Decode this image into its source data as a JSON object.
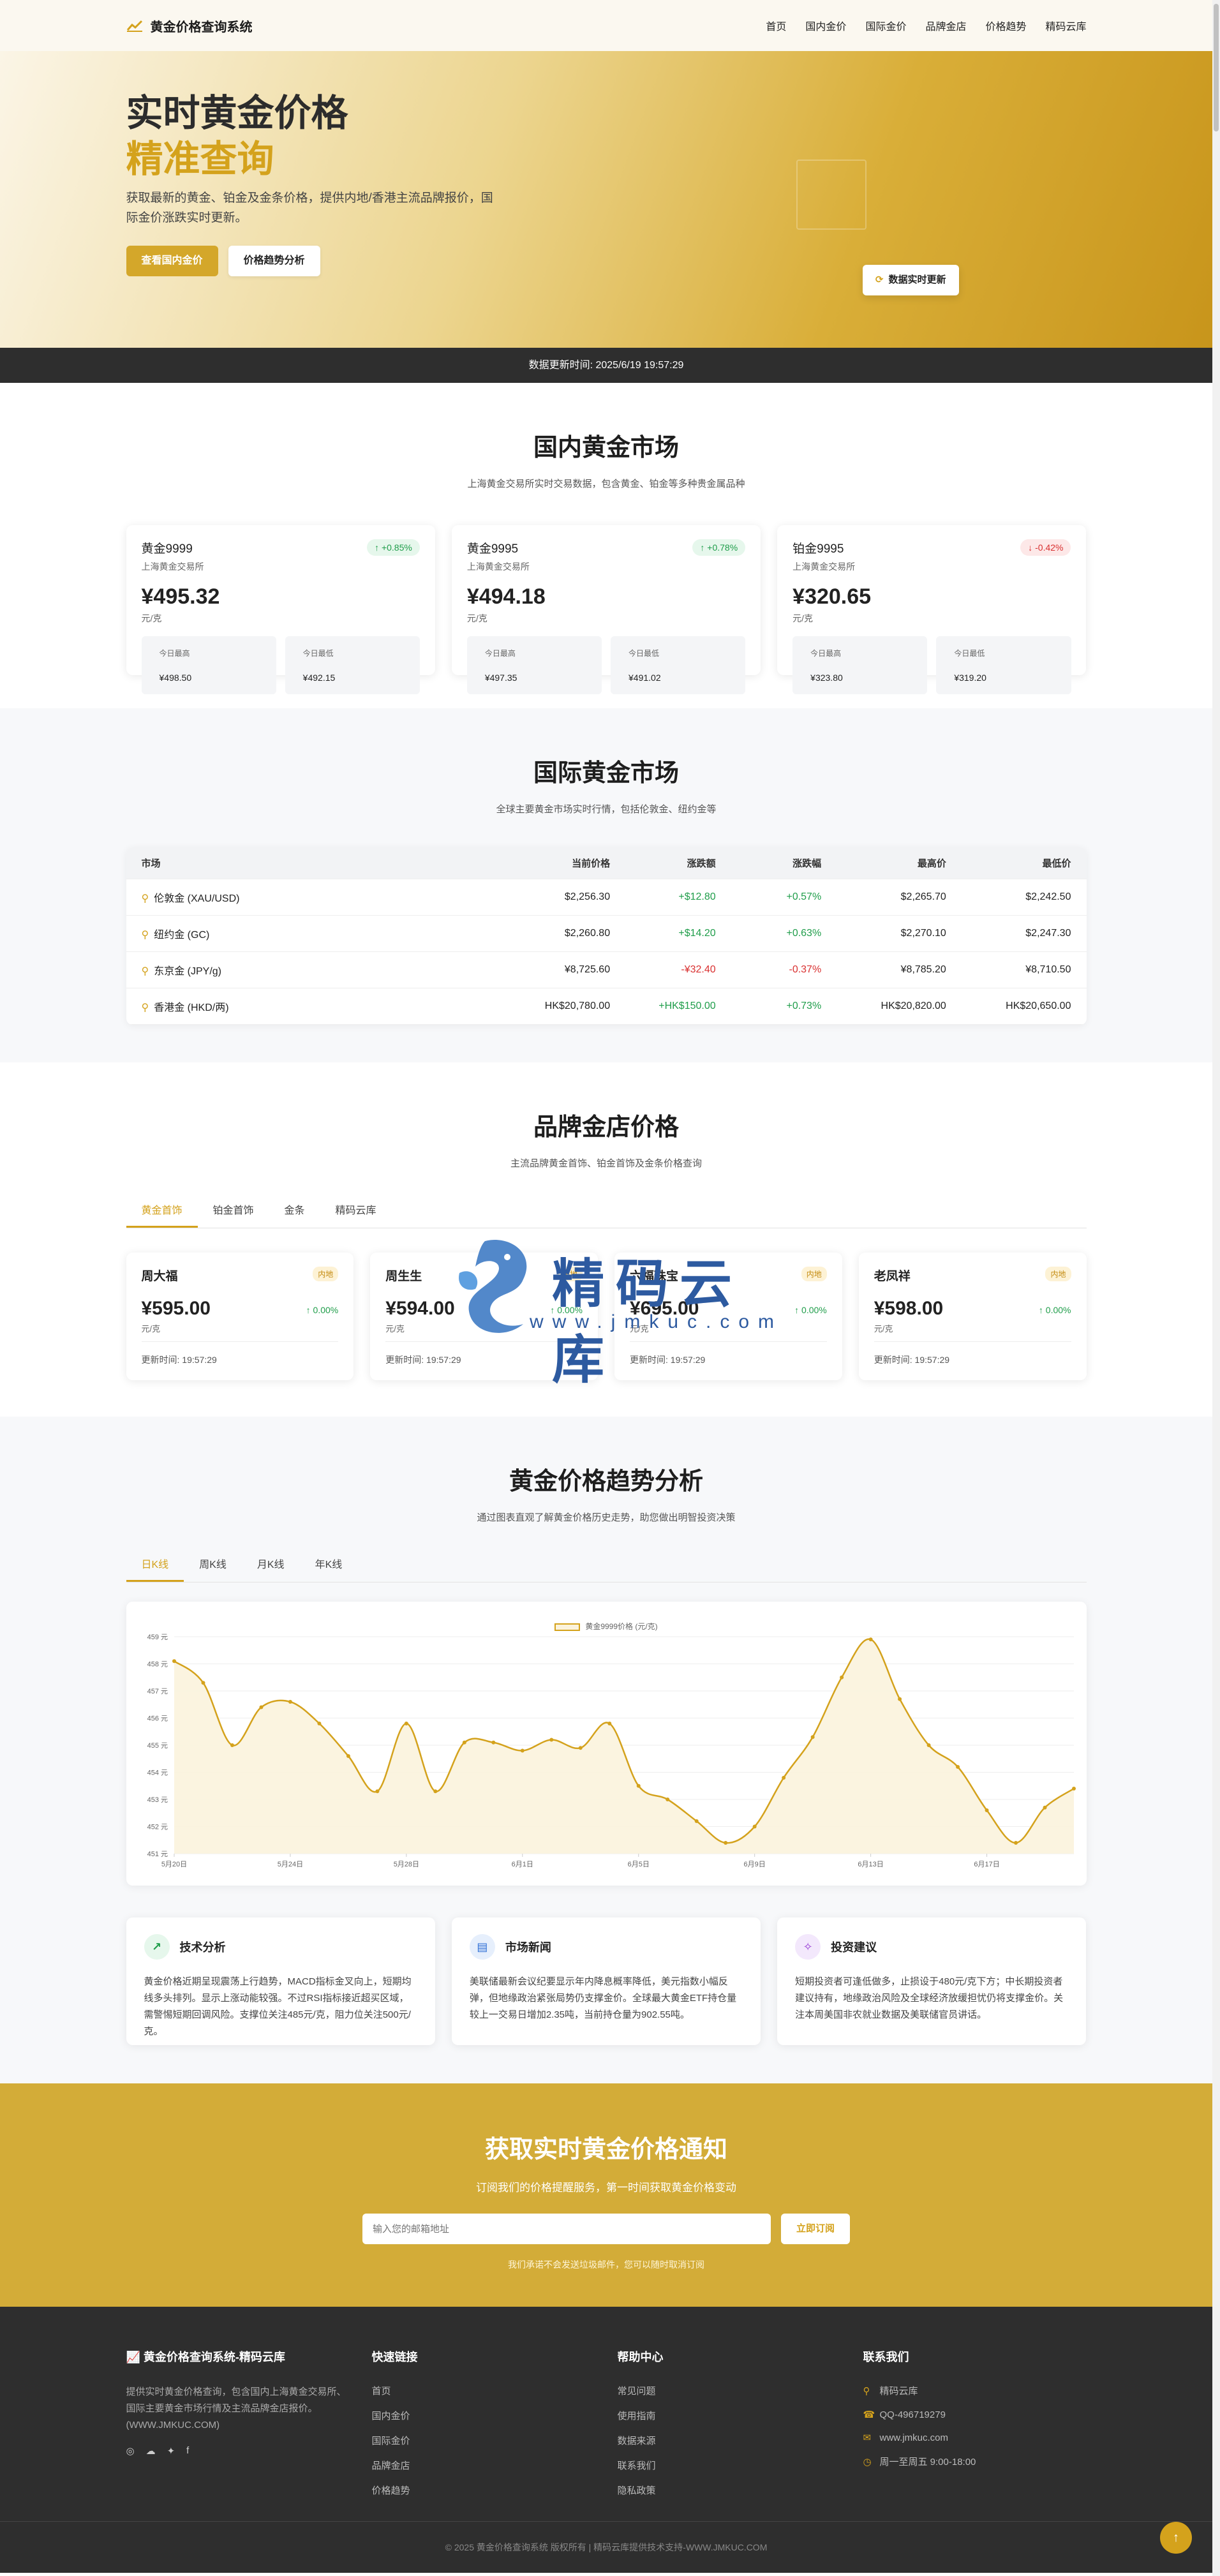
{
  "nav": {
    "brand": "黄金价格查询系统",
    "links": [
      "首页",
      "国内金价",
      "国际金价",
      "品牌金店",
      "价格趋势",
      "精码云库"
    ]
  },
  "hero": {
    "title_line1": "实时黄金价格",
    "title_line2": "精准查询",
    "desc": "获取最新的黄金、铂金及金条价格，提供内地/香港主流品牌报价，国际金价涨跌实时更新。",
    "btn_primary": "查看国内金价",
    "btn_secondary": "价格趋势分析",
    "live_label": "数据实时更新"
  },
  "update_bar": "数据更新时间: 2025/6/19 19:57:29",
  "domestic": {
    "title": "国内黄金市场",
    "subtitle": "上海黄金交易所实时交易数据，包含黄金、铂金等多种贵金属品种",
    "cards": [
      {
        "name": "黄金9999",
        "exchange": "上海黄金交易所",
        "change": "+0.85%",
        "dir": "up",
        "price": "¥495.32",
        "unit": "元/克",
        "high_label": "今日最高",
        "high": "¥498.50",
        "low_label": "今日最低",
        "low": "¥492.15"
      },
      {
        "name": "黄金9995",
        "exchange": "上海黄金交易所",
        "change": "+0.78%",
        "dir": "up",
        "price": "¥494.18",
        "unit": "元/克",
        "high_label": "今日最高",
        "high": "¥497.35",
        "low_label": "今日最低",
        "low": "¥491.02"
      },
      {
        "name": "铂金9995",
        "exchange": "上海黄金交易所",
        "change": "-0.42%",
        "dir": "down",
        "price": "¥320.65",
        "unit": "元/克",
        "high_label": "今日最高",
        "high": "¥323.80",
        "low_label": "今日最低",
        "low": "¥319.20"
      }
    ]
  },
  "intl": {
    "title": "国际黄金市场",
    "subtitle": "全球主要黄金市场实时行情，包括伦敦金、纽约金等",
    "headers": [
      "市场",
      "当前价格",
      "涨跌额",
      "涨跌幅",
      "最高价",
      "最低价"
    ],
    "rows": [
      {
        "market": "伦敦金 (XAU/USD)",
        "price": "$2,256.30",
        "chg": "+$12.80",
        "pct": "+0.57%",
        "high": "$2,265.70",
        "low": "$2,242.50",
        "dir": "up"
      },
      {
        "market": "纽约金 (GC)",
        "price": "$2,260.80",
        "chg": "+$14.20",
        "pct": "+0.63%",
        "high": "$2,270.10",
        "low": "$2,247.30",
        "dir": "up"
      },
      {
        "market": "东京金 (JPY/g)",
        "price": "¥8,725.60",
        "chg": "-¥32.40",
        "pct": "-0.37%",
        "high": "¥8,785.20",
        "low": "¥8,710.50",
        "dir": "down"
      },
      {
        "market": "香港金 (HKD/两)",
        "price": "HK$20,780.00",
        "chg": "+HK$150.00",
        "pct": "+0.73%",
        "high": "HK$20,820.00",
        "low": "HK$20,650.00",
        "dir": "up"
      }
    ]
  },
  "brands": {
    "title": "品牌金店价格",
    "subtitle": "主流品牌黄金首饰、铂金首饰及金条价格查询",
    "tabs": [
      "黄金首饰",
      "铂金首饰",
      "金条",
      "精码云库"
    ],
    "cards": [
      {
        "name": "周大福",
        "tag": "内地",
        "price": "¥595.00",
        "unit": "元/克",
        "change": "0.00%",
        "updated": "更新时间: 19:57:29"
      },
      {
        "name": "周生生",
        "tag": "内地",
        "price": "¥594.00",
        "unit": "元/克",
        "change": "0.00%",
        "updated": "更新时间: 19:57:29"
      },
      {
        "name": "六福珠宝",
        "tag": "内地",
        "price": "¥695.00",
        "unit": "元/克",
        "change": "0.00%",
        "updated": "更新时间: 19:57:29"
      },
      {
        "name": "老凤祥",
        "tag": "内地",
        "price": "¥598.00",
        "unit": "元/克",
        "change": "0.00%",
        "updated": "更新时间: 19:57:29"
      }
    ]
  },
  "watermark": {
    "cn": "精码云库",
    "en": "www.jmkuc.com"
  },
  "trend": {
    "title": "黄金价格趋势分析",
    "subtitle": "通过图表直观了解黄金价格历史走势，助您做出明智投资决策",
    "tabs": [
      "日K线",
      "周K线",
      "月K线",
      "年K线"
    ],
    "info": [
      {
        "title": "技术分析",
        "icon": "chart-line-icon",
        "color": "#1f9d4a",
        "bg": "#e6f7ec",
        "text": "黄金价格近期呈现震荡上行趋势，MACD指标金叉向上，短期均线多头排列。显示上涨动能较强。不过RSI指标接近超买区域，需警惕短期回调风险。支撑位关注485元/克，阻力位关注500元/克。"
      },
      {
        "title": "市场新闻",
        "icon": "newspaper-icon",
        "color": "#2f6fd6",
        "bg": "#e6effc",
        "text": "美联储最新会议纪要显示年内降息概率降低，美元指数小幅反弹，但地缘政治紧张局势仍支撑金价。全球最大黄金ETF持仓量较上一交易日增加2.35吨，当前持仓量为902.55吨。"
      },
      {
        "title": "投资建议",
        "icon": "lightbulb-icon",
        "color": "#9a3fd6",
        "bg": "#f3e8fc",
        "text": "短期投资者可逢低做多，止损设于480元/克下方；中长期投资者建议持有，地缘政治风险及全球经济放缓担忧仍将支撑金价。关注本周美国非农就业数据及美联储官员讲话。"
      }
    ]
  },
  "chart_data": {
    "type": "area",
    "title": "",
    "legend": [
      "黄金9999价格 (元/克)"
    ],
    "ylabel": "",
    "ylim": [
      451,
      459
    ],
    "yticks": [
      "459 元",
      "458 元",
      "457 元",
      "456 元",
      "455 元",
      "454 元",
      "453 元",
      "452 元",
      "451 元"
    ],
    "xticks": [
      "5月20日",
      "5月24日",
      "5月28日",
      "6月1日",
      "6月5日",
      "6月9日",
      "6月13日",
      "6月17日"
    ],
    "series": [
      {
        "name": "黄金9999价格 (元/克)",
        "color": "#d4a21c",
        "values": [
          458.1,
          457.3,
          455.0,
          456.4,
          456.6,
          455.8,
          454.6,
          453.3,
          455.8,
          453.3,
          455.1,
          455.1,
          454.8,
          455.2,
          454.9,
          455.8,
          453.5,
          453.0,
          452.2,
          451.4,
          452.0,
          453.8,
          455.3,
          457.5,
          458.9,
          456.7,
          455.0,
          454.2,
          452.6,
          451.4,
          452.7,
          453.4
        ]
      }
    ]
  },
  "subscribe": {
    "title": "获取实时黄金价格通知",
    "subtitle": "订阅我们的价格提醒服务，第一时间获取黄金价格变动",
    "placeholder": "输入您的邮箱地址",
    "button": "立即订阅",
    "note": "我们承诺不会发送垃圾邮件，您可以随时取消订阅"
  },
  "footer": {
    "brand": "黄金价格查询系统-精码云库",
    "desc": "提供实时黄金价格查询，包含国内上海黄金交易所、国际主要黄金市场行情及主流品牌金店报价。(WWW.JMKUC.COM)",
    "quick_title": "快速链接",
    "quick": [
      "首页",
      "国内金价",
      "国际金价",
      "品牌金店",
      "价格趋势"
    ],
    "help_title": "帮助中心",
    "help": [
      "常见问题",
      "使用指南",
      "数据来源",
      "联系我们",
      "隐私政策"
    ],
    "contact_title": "联系我们",
    "contact": [
      {
        "icon": "location-icon",
        "text": "精码云库"
      },
      {
        "icon": "phone-icon",
        "text": "QQ-496719279"
      },
      {
        "icon": "mail-icon",
        "text": "www.jmkuc.com"
      },
      {
        "icon": "clock-icon",
        "text": "周一至周五 9:00-18:00"
      }
    ],
    "copyright": "© 2025 黄金价格查询系统 版权所有 | 精码云库提供技术支持-WWW.JMKUC.COM"
  }
}
